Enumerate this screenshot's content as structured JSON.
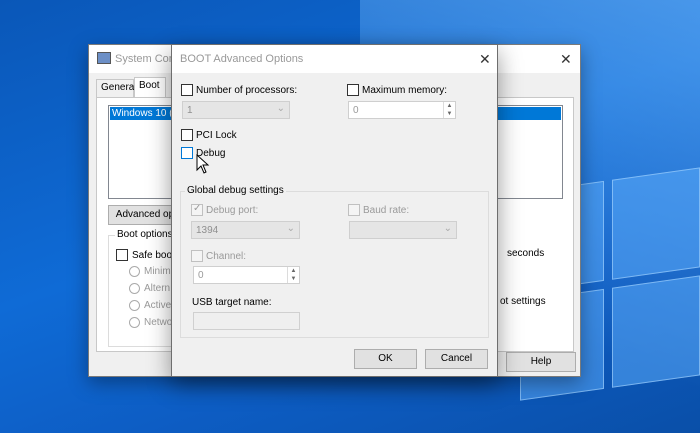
{
  "background": {
    "accent": "#0f6bd6"
  },
  "system_config": {
    "title": "System Conf",
    "tabs": [
      "General",
      "Boot"
    ],
    "os_entry": "Windows 10 (C",
    "advanced_button": "Advanced op",
    "boot_options_label": "Boot options",
    "safe_boot_label": "Safe boo",
    "radio_labels": [
      "Minima",
      "Altern",
      "Active",
      "Netwo"
    ],
    "timeout_suffix": "seconds",
    "boot_settings_suffix": "ot settings",
    "help_button": "Help",
    "close_glyph": "✕"
  },
  "dialog": {
    "title": "BOOT Advanced Options",
    "close_glyph": "✕",
    "num_processors_label": "Number of processors:",
    "num_processors_value": "1",
    "max_memory_label": "Maximum memory:",
    "max_memory_value": "0",
    "pci_lock_label": "PCI Lock",
    "debug_label": "Debug",
    "global_debug_label": "Global debug settings",
    "debug_port_label": "Debug port:",
    "debug_port_value": "1394",
    "baud_rate_label": "Baud rate:",
    "baud_rate_value": "",
    "channel_label": "Channel:",
    "channel_value": "0",
    "usb_target_label": "USB target name:",
    "usb_target_value": "",
    "ok_button": "OK",
    "cancel_button": "Cancel"
  }
}
